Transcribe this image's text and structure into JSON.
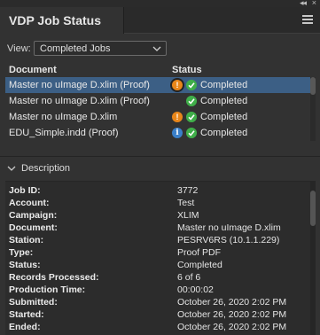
{
  "window": {
    "collapse_glyph": "◂◂",
    "close_glyph": "×"
  },
  "panel": {
    "title": "VDP Job Status",
    "menu_icon": "hamburger-menu-icon"
  },
  "view": {
    "label": "View:",
    "selected": "Completed Jobs",
    "chevron_icon": "chevron-down-icon"
  },
  "table": {
    "headers": {
      "document": "Document",
      "status": "Status"
    },
    "rows": [
      {
        "document": "Master no uImage D.xlim (Proof)",
        "indicator": "warning",
        "indicator_glyph": "!",
        "status": "Completed",
        "selected": true
      },
      {
        "document": "Master no uImage D.xlim (Proof)",
        "indicator": "",
        "indicator_glyph": "",
        "status": "Completed",
        "selected": false
      },
      {
        "document": "Master no uImage D.xlim",
        "indicator": "warning",
        "indicator_glyph": "!",
        "status": "Completed",
        "selected": false
      },
      {
        "document": "EDU_Simple.indd (Proof)",
        "indicator": "info",
        "indicator_glyph": "i",
        "status": "Completed",
        "selected": false
      }
    ]
  },
  "description": {
    "title": "Description",
    "fields": [
      {
        "key": "Job ID:",
        "value": "3772"
      },
      {
        "key": "Account:",
        "value": "Test"
      },
      {
        "key": "Campaign:",
        "value": "XLIM"
      },
      {
        "key": "Document:",
        "value": "Master no uImage D.xlim"
      },
      {
        "key": "Station:",
        "value": "PESRV6RS (10.1.1.229)"
      },
      {
        "key": "Type:",
        "value": "Proof PDF"
      },
      {
        "key": "Status:",
        "value": "Completed"
      },
      {
        "key": "Records Processed:",
        "value": "6 of 6"
      },
      {
        "key": "Production Time:",
        "value": "00:00:02"
      },
      {
        "key": "Submitted:",
        "value": "October 26, 2020 2:02 PM"
      },
      {
        "key": "Started:",
        "value": "October 26, 2020 2:02 PM"
      },
      {
        "key": "Ended:",
        "value": "October 26, 2020 2:02 PM"
      }
    ]
  },
  "colors": {
    "selection": "#3c5f85",
    "warning": "#e8861a",
    "info": "#3a7fc8",
    "success": "#3fae49"
  }
}
